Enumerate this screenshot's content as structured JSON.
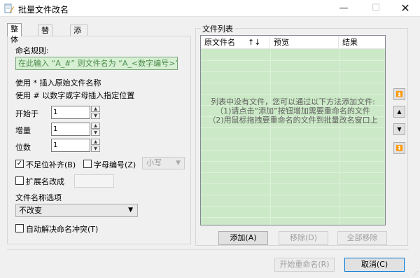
{
  "window": {
    "title": "批量文件改名",
    "minimize_glyph": "—",
    "maximize_glyph": "☐",
    "close_glyph": "✕",
    "icon": "rename-app-icon"
  },
  "tabs": [
    {
      "label": "整体",
      "active": true
    },
    {
      "label": "替换",
      "active": false
    },
    {
      "label": "添加/删除",
      "active": false
    }
  ],
  "rules": {
    "label": "命名规则:",
    "pattern_placeholder": "在此输入 “A_#” 则文件名为 “A_<数字编号>”",
    "hint1": "使用 * 插入原始文件名称",
    "hint2": "使用 # 以数字或字母插入指定位置"
  },
  "fields": {
    "start_label": "开始于",
    "start_value": "1",
    "step_label": "增量",
    "step_value": "1",
    "digits_label": "位数",
    "digits_value": "1"
  },
  "options": {
    "pad_label": "不足位补齐(B)",
    "pad_checked": true,
    "letter_label": "字母编号(Z)",
    "letter_checked": false,
    "case_value": "小写",
    "ext_label": "扩展名改成",
    "ext_checked": false,
    "name_option_label": "文件名称选项",
    "name_option_value": "不改变",
    "auto_resolve_label": "自动解决命名冲突(T)",
    "auto_resolve_checked": false
  },
  "file_list": {
    "group_label": "文件列表",
    "columns": [
      "原文件名",
      "预览",
      "结果"
    ],
    "sort_glyph": "↑↓",
    "empty_hint": [
      "列表中没有文件，您可以通过以下方法添加文件:",
      "（1)请点击“添加”按钮增加需要重命名的文件",
      "（2)用鼠标拖拽要重命名的文件到批量改名窗口上"
    ],
    "add_label": "添加(A)",
    "remove_label": "移除(D)",
    "remove_all_label": "全部移除"
  },
  "side_buttons": [
    {
      "name": "move-top",
      "glyph": "⏫"
    },
    {
      "name": "move-up",
      "glyph": "▲"
    },
    {
      "name": "move-down",
      "glyph": "▼"
    },
    {
      "name": "move-bottom",
      "glyph": "⏬"
    }
  ],
  "footer": {
    "start_label": "开始重命名(R)",
    "cancel_label": "取消(C)"
  },
  "colors": {
    "list_bg": "#cbe9c6",
    "pattern_bg": "#d7f0d4",
    "pattern_text": "#4a8a4a",
    "default_button_border": "#0078d7"
  }
}
